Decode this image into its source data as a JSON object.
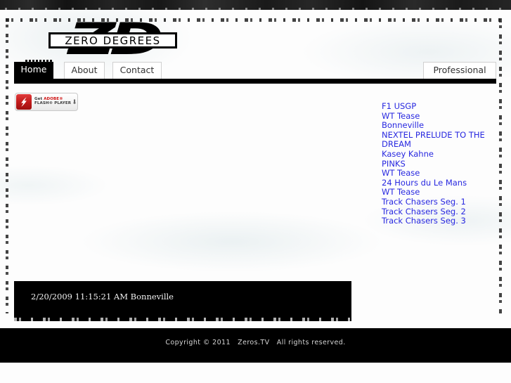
{
  "site": {
    "logo_mark": "ZD",
    "logo_text": "ZERO DEGREES"
  },
  "nav": {
    "tabs": [
      {
        "label": "Home",
        "active": true
      },
      {
        "label": "About",
        "active": false
      },
      {
        "label": "Contact",
        "active": false
      }
    ],
    "right_tab": {
      "label": "Professional",
      "active": false
    }
  },
  "flash_badge": {
    "line1_prefix": "Get ",
    "line1_brand": "ADOBE®",
    "line2": "FLASH® PLAYER",
    "arrow_icon": "download-arrow-icon",
    "icon_name": "flash-player-icon",
    "icon_color": "#c21b1b"
  },
  "video": {
    "caption": "2/20/2009 11:15:21 AM Bonneville",
    "background_color": "#000000"
  },
  "links": {
    "color": "#2828e0",
    "items": [
      "F1 USGP",
      "WT Tease",
      "Bonneville",
      "NEXTEL PRELUDE TO THE DREAM",
      "Kasey Kahne",
      "PINKS",
      "WT Tease",
      "24 Hours du Le Mans",
      "WT Tease",
      "Track Chasers Seg. 1",
      "Track Chasers Seg. 2",
      "Track Chasers Seg. 3"
    ]
  },
  "footer": {
    "text": "Copyright © 2011   Zeros.TV   All rights reserved."
  }
}
